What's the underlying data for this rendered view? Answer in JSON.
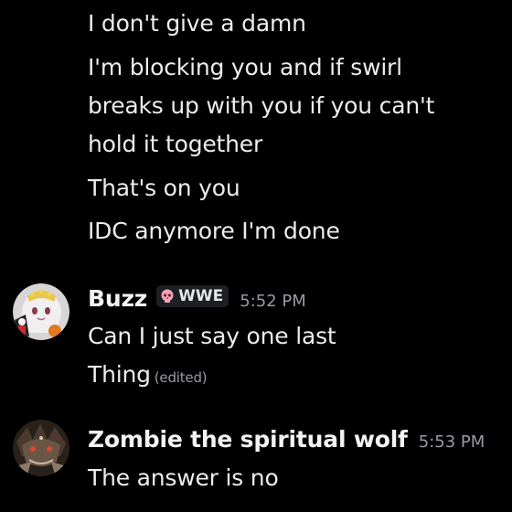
{
  "continued_messages": [
    "I don't give a damn",
    "I'm blocking you and if swirl",
    "breaks up with you if you can't",
    "hold it together",
    "That's on you",
    "IDC anymore I'm done"
  ],
  "messages": [
    {
      "username": "Buzz",
      "tag": "WWE",
      "tag_icon": "pink-skull-icon",
      "timestamp": "5:52 PM",
      "lines": [
        "Can I just say one last",
        "Thing"
      ],
      "edited": "(edited)"
    },
    {
      "username": "Zombie the spiritual wolf",
      "timestamp": "5:53 PM",
      "lines": [
        "The answer is no"
      ]
    }
  ],
  "colors": {
    "background": "#000000",
    "text": "#ececec",
    "muted": "#9a9ba2",
    "tag_background": "#1e1f22"
  }
}
